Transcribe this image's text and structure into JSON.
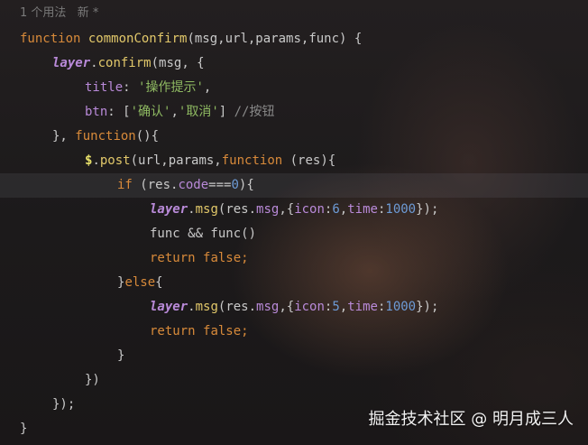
{
  "editor": {
    "usage_hint": "1 个用法   新 *",
    "highlight_line": 8
  },
  "code": {
    "l1": {
      "kw": "function",
      "name": "commonConfirm",
      "rest": "(msg,url,params,func) {"
    },
    "l2": {
      "obj": "layer",
      "dot": ".",
      "method": "confirm",
      "rest": "(msg, {"
    },
    "l3": {
      "key": "title",
      "colon": ": ",
      "str": "'操作提示'",
      "tail": ","
    },
    "l4": {
      "key": "btn",
      "colon": ": [",
      "s1": "'确认'",
      "comma": ",",
      "s2": "'取消'",
      "close": "] ",
      "comment": "//按钮"
    },
    "l5": {
      "lead": "}, ",
      "kw": "function",
      "rest": "(){"
    },
    "l6": {
      "dollar": "$",
      "dot": ".",
      "method": "post",
      "open": "(url,params,",
      "kw": "function",
      "rest": " (res){"
    },
    "l7": {
      "kw": "if",
      "pre": " (res.",
      "prop": "code",
      "op": "===",
      "num": "0",
      "rest": "){"
    },
    "l8": {
      "obj": "layer",
      "dot": ".",
      "method": "msg",
      "p1": "(res.",
      "prop1": "msg",
      "p2": ",{",
      "prop2": "icon",
      "c1": ":",
      "num1": "6",
      "p3": ",",
      "prop3": "time",
      "c2": ":",
      "num2": "1000",
      "rest": "});"
    },
    "l9": {
      "text": "func && func()"
    },
    "l10": {
      "kw1": "return",
      "sp": " ",
      "kw2": "false",
      "rest": ";"
    },
    "l11": {
      "lead": "}",
      "kw": "else",
      "rest": "{"
    },
    "l12": {
      "obj": "layer",
      "dot": ".",
      "method": "msg",
      "p1": "(res.",
      "prop1": "msg",
      "p2": ",{",
      "prop2": "icon",
      "c1": ":",
      "num1": "5",
      "p3": ",",
      "prop3": "time",
      "c2": ":",
      "num2": "1000",
      "rest": "});"
    },
    "l13": {
      "kw1": "return",
      "sp": " ",
      "kw2": "false",
      "rest": ";"
    },
    "l14": {
      "text": "}"
    },
    "l15": {
      "text": "})"
    },
    "l16": {
      "text": "});"
    },
    "l17": {
      "text": "}"
    }
  },
  "watermark": "掘金技术社区 @ 明月成三人"
}
